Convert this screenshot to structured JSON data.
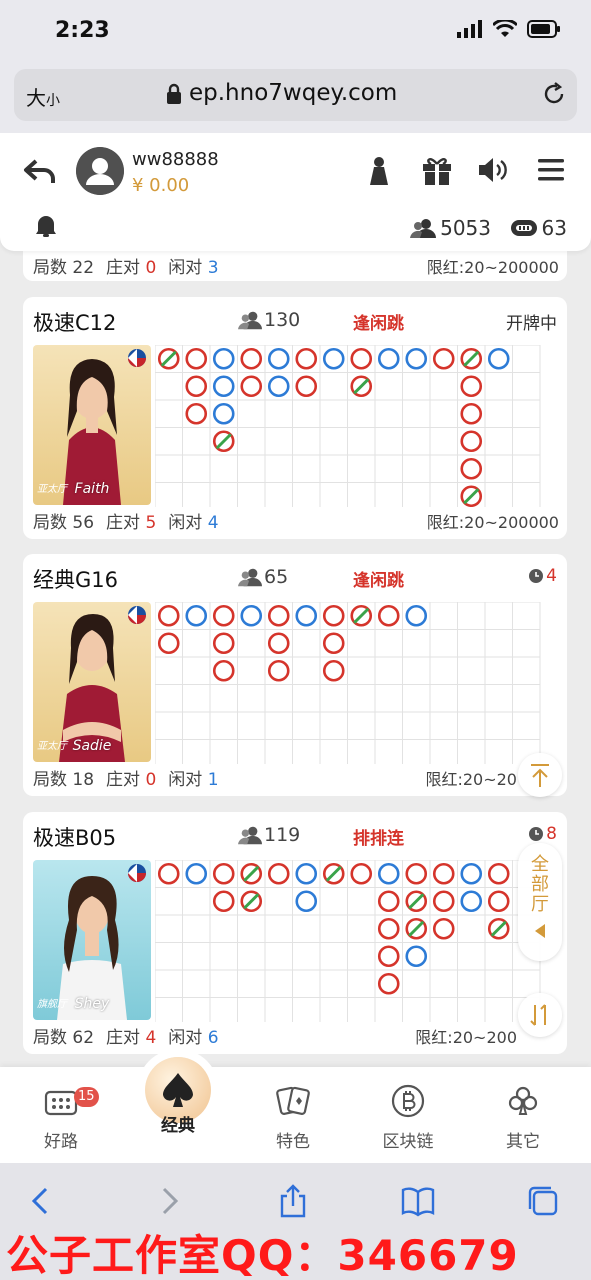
{
  "status_bar": {
    "time": "2:23"
  },
  "browser": {
    "text_size_label": "大",
    "text_size_small": "小",
    "url": "ep.hno7wqey.com"
  },
  "header": {
    "username": "ww88888",
    "balance": "¥ 0.00",
    "online_count": "5053",
    "table_count": "63"
  },
  "prev_card": {
    "rounds_label": "局数",
    "rounds": "22",
    "banker_pair_label": "庄对",
    "banker_pair": "0",
    "player_pair_label": "闲对",
    "player_pair": "3",
    "limit": "限红:20~200000"
  },
  "cards": [
    {
      "title": "极速C12",
      "players": "130",
      "pattern": "逢闲跳",
      "status": "开牌中",
      "dealer": "Faith",
      "hall": "亚太厅",
      "rounds_label": "局数",
      "rounds": "56",
      "banker_pair_label": "庄对",
      "banker_pair": "5",
      "player_pair_label": "闲对",
      "player_pair": "4",
      "limit": "限红:20~200000"
    },
    {
      "title": "经典G16",
      "players": "65",
      "pattern": "逢闲跳",
      "status": "4",
      "dealer": "Sadie",
      "hall": "亚太厅",
      "rounds_label": "局数",
      "rounds": "18",
      "banker_pair_label": "庄对",
      "banker_pair": "0",
      "player_pair_label": "闲对",
      "player_pair": "1",
      "limit": "限红:20~20"
    },
    {
      "title": "极速B05",
      "players": "119",
      "pattern": "排排连",
      "status": "8",
      "dealer": "Shey",
      "hall": "旗舰厅",
      "rounds_label": "局数",
      "rounds": "62",
      "banker_pair_label": "庄对",
      "banker_pair": "4",
      "player_pair_label": "闲对",
      "player_pair": "6",
      "limit": "限红:20~200"
    }
  ],
  "floats": {
    "all_halls": [
      "全",
      "部",
      "厅"
    ]
  },
  "tabs": [
    {
      "label": "好路",
      "badge": "15"
    },
    {
      "label": "经典"
    },
    {
      "label": "特色"
    },
    {
      "label": "区块链"
    },
    {
      "label": "其它"
    }
  ],
  "watermark": "公子工作室QQ：346679",
  "colors": {
    "banker": "#d5342b",
    "player": "#2d7bd6",
    "tie": "#3aa34a",
    "accent": "#d39a3a"
  }
}
